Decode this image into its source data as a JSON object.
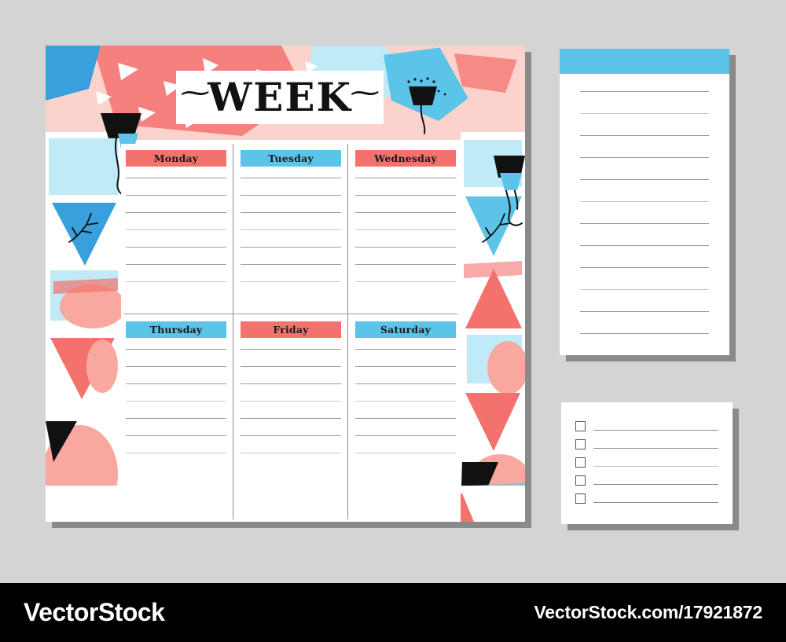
{
  "planner": {
    "title": "WEEK",
    "swash_left": "~",
    "swash_right": "~",
    "rows": [
      {
        "days": [
          {
            "label": "Monday",
            "color": "#f4726e",
            "chip": "coral",
            "lines": 7
          },
          {
            "label": "Tuesday",
            "color": "#5cc4e8",
            "chip": "blue",
            "lines": 7
          },
          {
            "label": "Wednesday",
            "color": "#f4726e",
            "chip": "coral",
            "lines": 7
          }
        ]
      },
      {
        "days": [
          {
            "label": "Thursday",
            "color": "#5cc4e8",
            "chip": "blue",
            "lines": 7
          },
          {
            "label": "Friday",
            "color": "#f4726e",
            "chip": "coral",
            "lines": 7
          },
          {
            "label": "Saturday",
            "color": "#5cc4e8",
            "chip": "blue",
            "lines": 7
          }
        ]
      }
    ]
  },
  "notepad": {
    "header_color": "#5cc4e8",
    "line_count": 12
  },
  "checklist": {
    "item_count": 5,
    "checkbox_icon": "empty-checkbox-icon"
  },
  "footer": {
    "brand": "VectorStock",
    "url": "VectorStock.com/17921872"
  },
  "palette": {
    "coral": "#f4726e",
    "coral_light": "#f9a8a0",
    "pink_pale": "#fbd2cc",
    "blue": "#5cc4e8",
    "blue_deep": "#3aa0dd",
    "blue_pale": "#bfeaf6",
    "black": "#111111",
    "white": "#ffffff",
    "background": "#d4d4d4",
    "shadow": "#8a8a8a",
    "rule": "#9a9a9a"
  }
}
